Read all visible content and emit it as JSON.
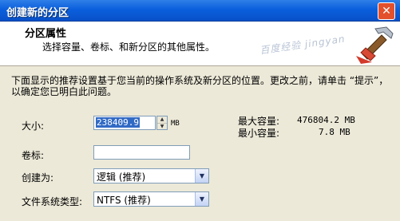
{
  "window": {
    "title": "创建新的分区"
  },
  "header": {
    "title": "分区属性",
    "subtitle": "选择容量、卷标、和新分区的其他属性。",
    "watermark": "百度经验 jingyan"
  },
  "description": "下面显示的推荐设置基于您当前的操作系统及新分区的位置。更改之前，请单击 “提示”，以确定您已明白此问题。",
  "size": {
    "label": "大小:",
    "value": "238409.9",
    "unit": "MB"
  },
  "capacity": {
    "max_label": "最大容量:",
    "max_value": "476804.2 MB",
    "min_label": "最小容量:",
    "min_value": "7.8 MB"
  },
  "volume_label": {
    "label": "卷标:",
    "value": ""
  },
  "create_as": {
    "label": "创建为:",
    "value": "逻辑 (推荐)"
  },
  "filesystem": {
    "label": "文件系统类型:",
    "value": "NTFS (推荐)"
  },
  "icons": [
    "close-icon",
    "hammer-icon",
    "spinner-up-icon",
    "spinner-down-icon",
    "dropdown-arrow-icon"
  ]
}
